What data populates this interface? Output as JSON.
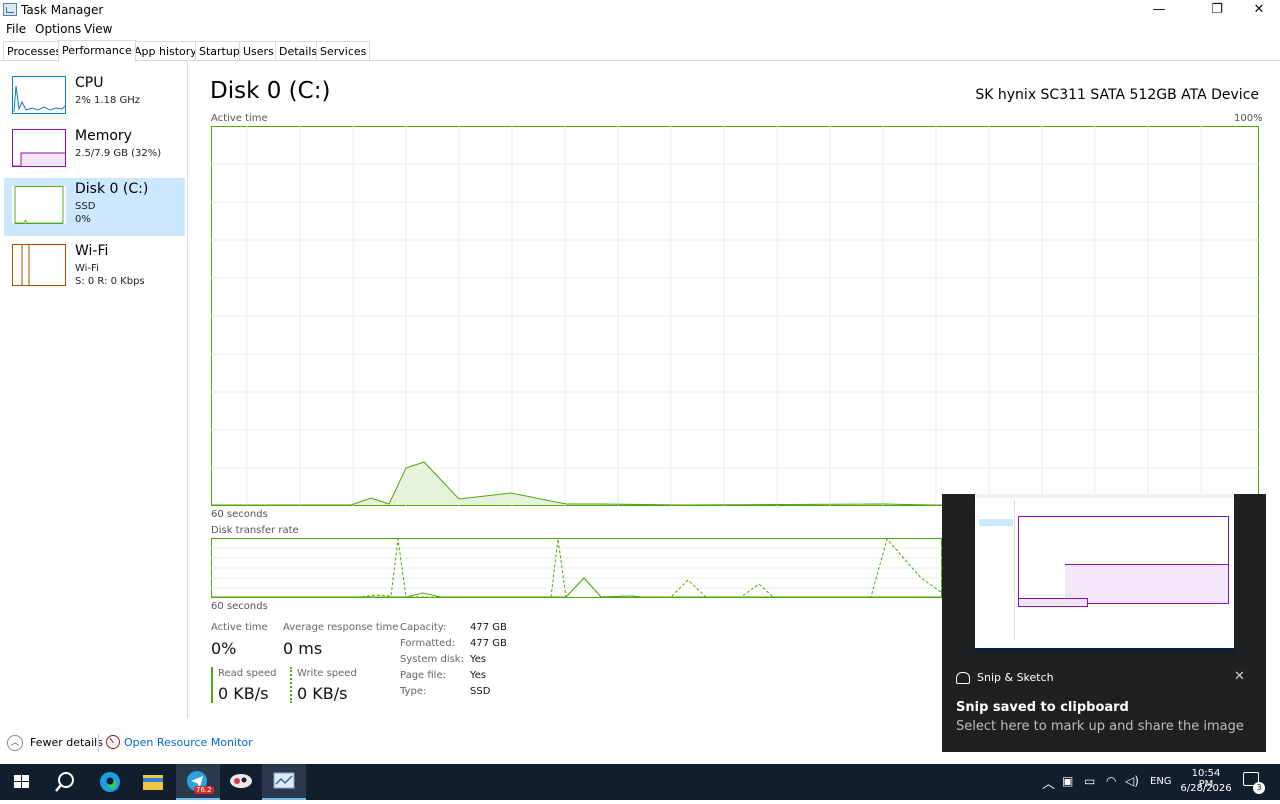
{
  "window": {
    "title": "Task Manager",
    "minimize": "—",
    "maximize": "❐",
    "close": "✕"
  },
  "menu": [
    "File",
    "Options",
    "View"
  ],
  "tabs": [
    "Processes",
    "Performance",
    "App history",
    "Startup",
    "Users",
    "Details",
    "Services"
  ],
  "sidebar": {
    "cpu": {
      "name": "CPU",
      "line1": "2%  1.18 GHz"
    },
    "memory": {
      "name": "Memory",
      "line1": "2.5/7.9 GB (32%)"
    },
    "disk": {
      "name": "Disk 0 (C:)",
      "line1": "SSD",
      "line2": "0%"
    },
    "wifi": {
      "name": "Wi-Fi",
      "line1": "Wi-Fi",
      "line2": "S: 0  R: 0 Kbps"
    }
  },
  "main": {
    "title": "Disk 0 (C:)",
    "device": "SK hynix SC311 SATA 512GB ATA Device",
    "active_time_label": "Active time",
    "max_label": "100%",
    "seconds_label": "60 seconds",
    "transfer_label": "Disk transfer rate",
    "seconds_label2": "60 seconds"
  },
  "stats": {
    "active_time_label": "Active time",
    "active_time_value": "0%",
    "avg_resp_label": "Average response time",
    "avg_resp_value": "0 ms",
    "read_label": "Read speed",
    "read_value": "0 KB/s",
    "write_label": "Write speed",
    "write_value": "0 KB/s"
  },
  "properties": [
    {
      "label": "Capacity:",
      "value": "477 GB"
    },
    {
      "label": "Formatted:",
      "value": "477 GB"
    },
    {
      "label": "System disk:",
      "value": "Yes"
    },
    {
      "label": "Page file:",
      "value": "Yes"
    },
    {
      "label": "Type:",
      "value": "SSD"
    }
  ],
  "footer": {
    "fewer": "Fewer details",
    "resmon": "Open Resource Monitor"
  },
  "toast": {
    "app": "Snip & Sketch",
    "title": "Snip saved to clipboard",
    "body": "Select here to mark up and share the image"
  },
  "taskbar": {
    "time": "10:54 PM",
    "date": "6/28/2026",
    "lang": "ENG",
    "badge": "76.2",
    "notif": "3"
  },
  "colors": {
    "disk_green": "#4da60c",
    "cpu_blue": "#117dbb",
    "memory_purple": "#8b12ae",
    "wifi_orange": "#a74f01",
    "selected_bg": "#cce8ff",
    "taskbar_bg": "#101e2e"
  }
}
